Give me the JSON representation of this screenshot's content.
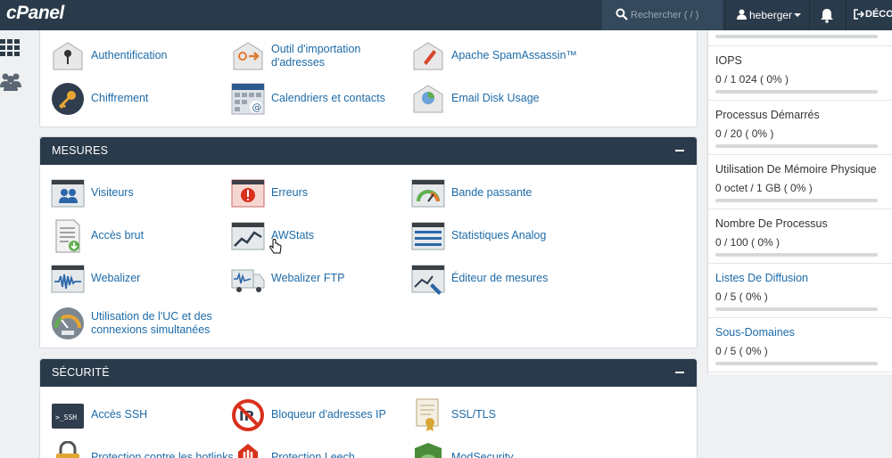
{
  "header": {
    "logo": "cPanel",
    "search_placeholder": "Rechercher ( / )",
    "username": "heberger",
    "logout_label": "DÉCON"
  },
  "top_panel": {
    "items": [
      {
        "label": "Authentification",
        "icon": "lock-key-icon"
      },
      {
        "label": "Outil d'importation",
        "label2": "d'adresses",
        "icon": "address-import-icon"
      },
      {
        "label": "Apache SpamAssassin™",
        "icon": "spam-pen-icon"
      },
      {
        "label": "Chiffrement",
        "icon": "key-icon"
      },
      {
        "label": "Calendriers et contacts",
        "icon": "calendar-icon"
      },
      {
        "label": "Email Disk Usage",
        "icon": "disk-usage-icon"
      }
    ]
  },
  "metrics": {
    "title": "MESURES",
    "items": [
      {
        "label": "Visiteurs",
        "icon": "visitors-icon"
      },
      {
        "label": "Erreurs",
        "icon": "errors-icon"
      },
      {
        "label": "Bande passante",
        "icon": "bandwidth-gauge-icon"
      },
      {
        "label": "Accès brut",
        "icon": "raw-access-icon"
      },
      {
        "label": "AWStats",
        "icon": "awstats-icon"
      },
      {
        "label": "Statistiques Analog",
        "icon": "analog-stats-icon"
      },
      {
        "label": "Webalizer",
        "icon": "webalizer-icon"
      },
      {
        "label": "Webalizer FTP",
        "icon": "webalizer-ftp-icon"
      },
      {
        "label": "Éditeur de mesures",
        "icon": "metrics-editor-icon"
      },
      {
        "label": "Utilisation de l'UC et des",
        "label2": "connexions simultanées",
        "icon": "cpu-usage-icon"
      }
    ]
  },
  "security": {
    "title": "SÉCURITÉ",
    "items": [
      {
        "label": "Accès SSH",
        "icon": "ssh-terminal-icon"
      },
      {
        "label": "Bloqueur d'adresses IP",
        "icon": "ip-blocker-icon"
      },
      {
        "label": "SSL/TLS",
        "icon": "certificate-icon"
      },
      {
        "label": "Protection contre les hotlinks",
        "icon": "hotlink-lock-icon"
      },
      {
        "label": "Protection Leech",
        "icon": "leech-hand-icon"
      },
      {
        "label": "ModSecurity",
        "icon": "modsecurity-shield-icon"
      }
    ]
  },
  "stats": [
    {
      "name": "IOPS",
      "value": "0 / 1 024 ( 0% )",
      "usage": 0,
      "link": false
    },
    {
      "name": "Processus Démarrés",
      "value": "0 / 20 ( 0% )",
      "usage": 0,
      "link": false
    },
    {
      "name": "Utilisation De Mémoire Physique",
      "value": "0 octet / 1 GB ( 0% )",
      "usage": 0,
      "link": false
    },
    {
      "name": "Nombre De Processus",
      "value": "0 / 100 ( 0% )",
      "usage": 0,
      "link": false
    },
    {
      "name": "Listes De Diffusion",
      "value": "0 / 5 ( 0% )",
      "usage": 0,
      "link": true
    },
    {
      "name": "Sous-Domaines",
      "value": "0 / 5 ( 0% )",
      "usage": 0,
      "link": true
    }
  ],
  "colors": {
    "header_bg": "#293a4a",
    "link": "#1d6ba8",
    "bar_fill": "#5aa7d8"
  }
}
